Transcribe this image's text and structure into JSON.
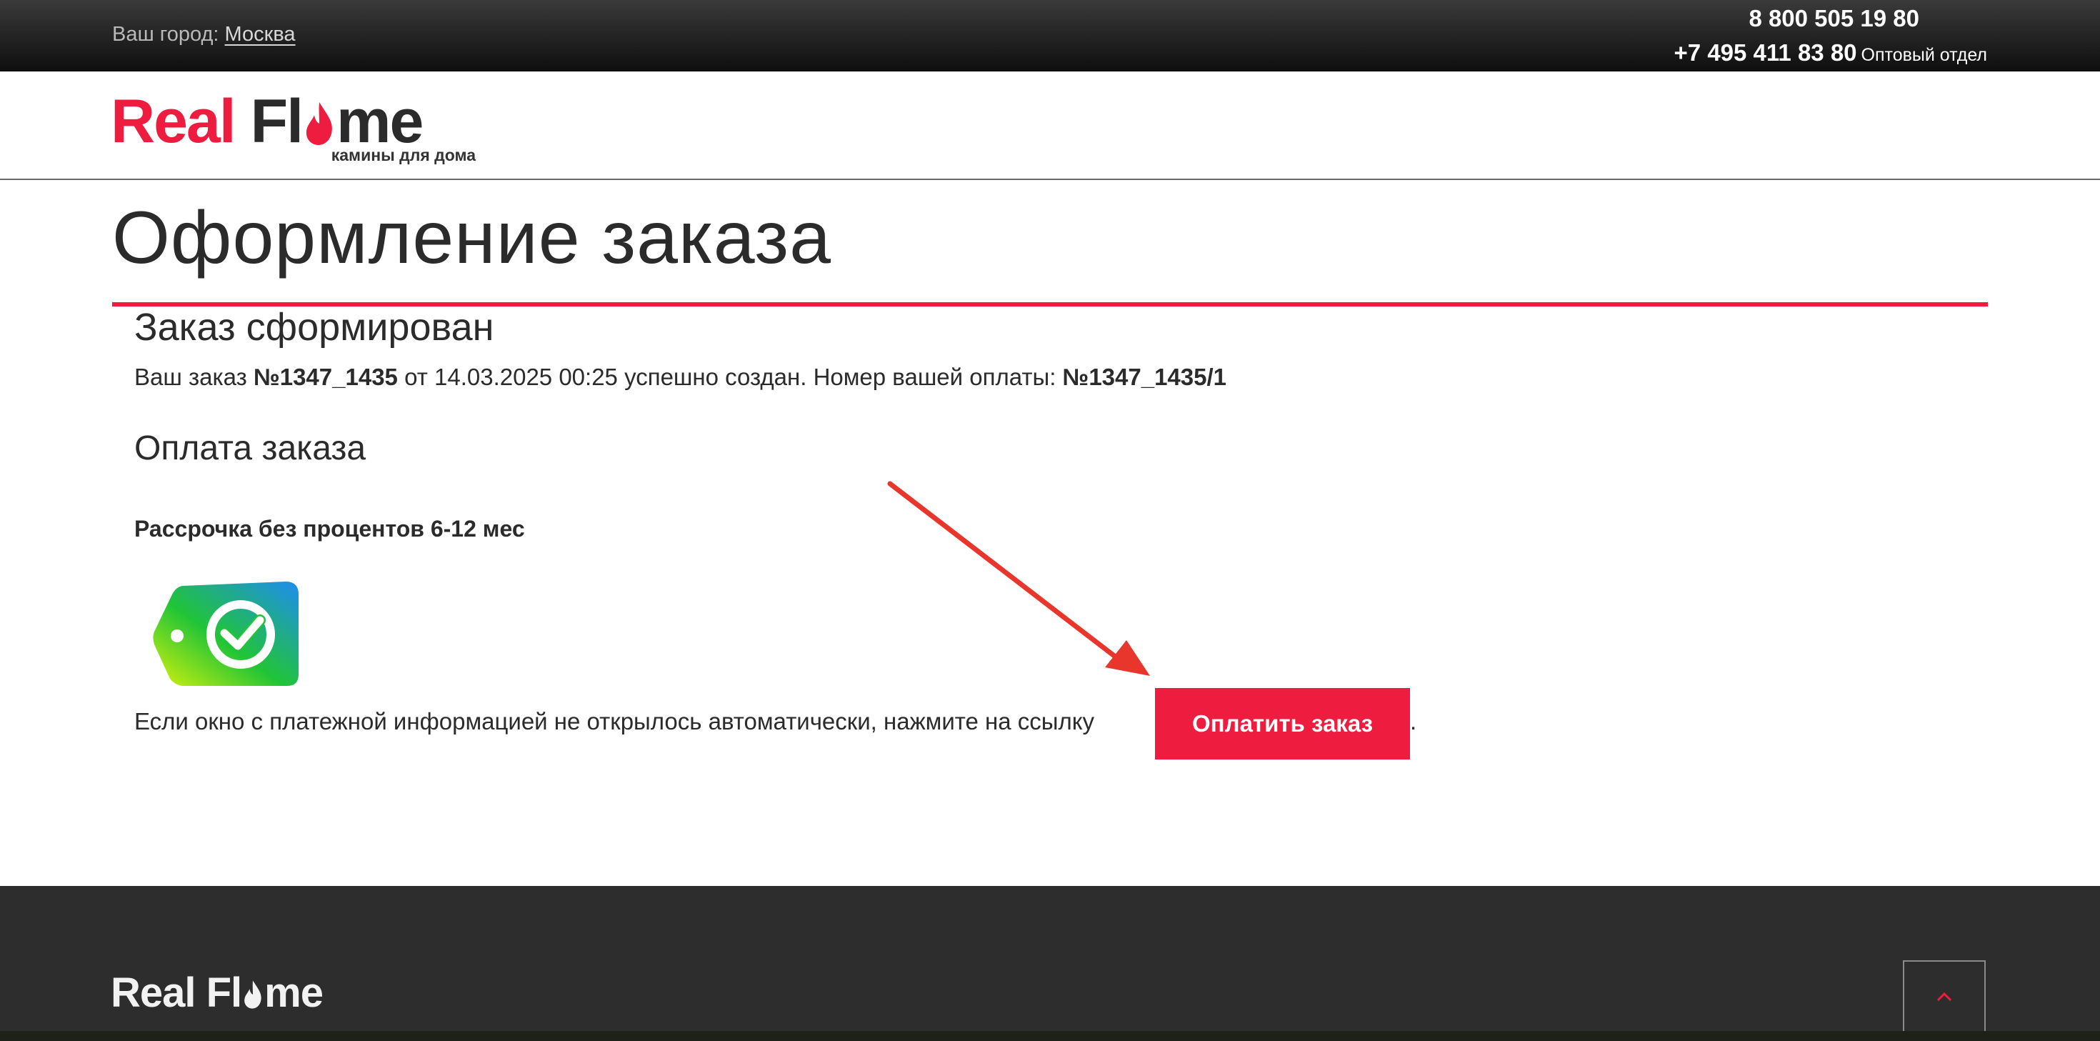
{
  "topbar": {
    "city_label": "Ваш город:",
    "city_value": "Москва",
    "phone_main": "8 800 505 19 80",
    "phone_secondary": "+7 495 411 83 80",
    "phone_secondary_label": "Оптовый отдел"
  },
  "header": {
    "logo_part1": "Real",
    "logo_part2": "Fl",
    "logo_part3": "me",
    "logo_tagline": "камины для дома"
  },
  "main": {
    "page_title": "Оформление заказа",
    "order_heading": "Заказ сформирован",
    "order_text_1": "Ваш заказ ",
    "order_number": "№1347_1435",
    "order_text_2": " от 14.03.2025 00:25 успешно создан. Номер вашей оплаты: ",
    "payment_number": "№1347_1435/1",
    "payment_heading": "Оплата заказа",
    "installment_title": "Рассрочка без процентов 6-12 мес",
    "payment_icon": "sber-payment-tag-icon",
    "hint_text": "Если окно с платежной информацией не открылось автоматически, нажмите на ссылку",
    "pay_button_label": "Оплатить заказ",
    "hint_tail": "."
  },
  "footer": {
    "logo_part1": "Real Fl",
    "logo_part2": "me",
    "scroll_top_icon": "chevron-up-icon"
  },
  "colors": {
    "brand_red": "#ee1c3e",
    "topbar_bg": "#1a1a1a",
    "footer_bg": "#2d2d2d",
    "text_dark": "#2b2b2b"
  }
}
